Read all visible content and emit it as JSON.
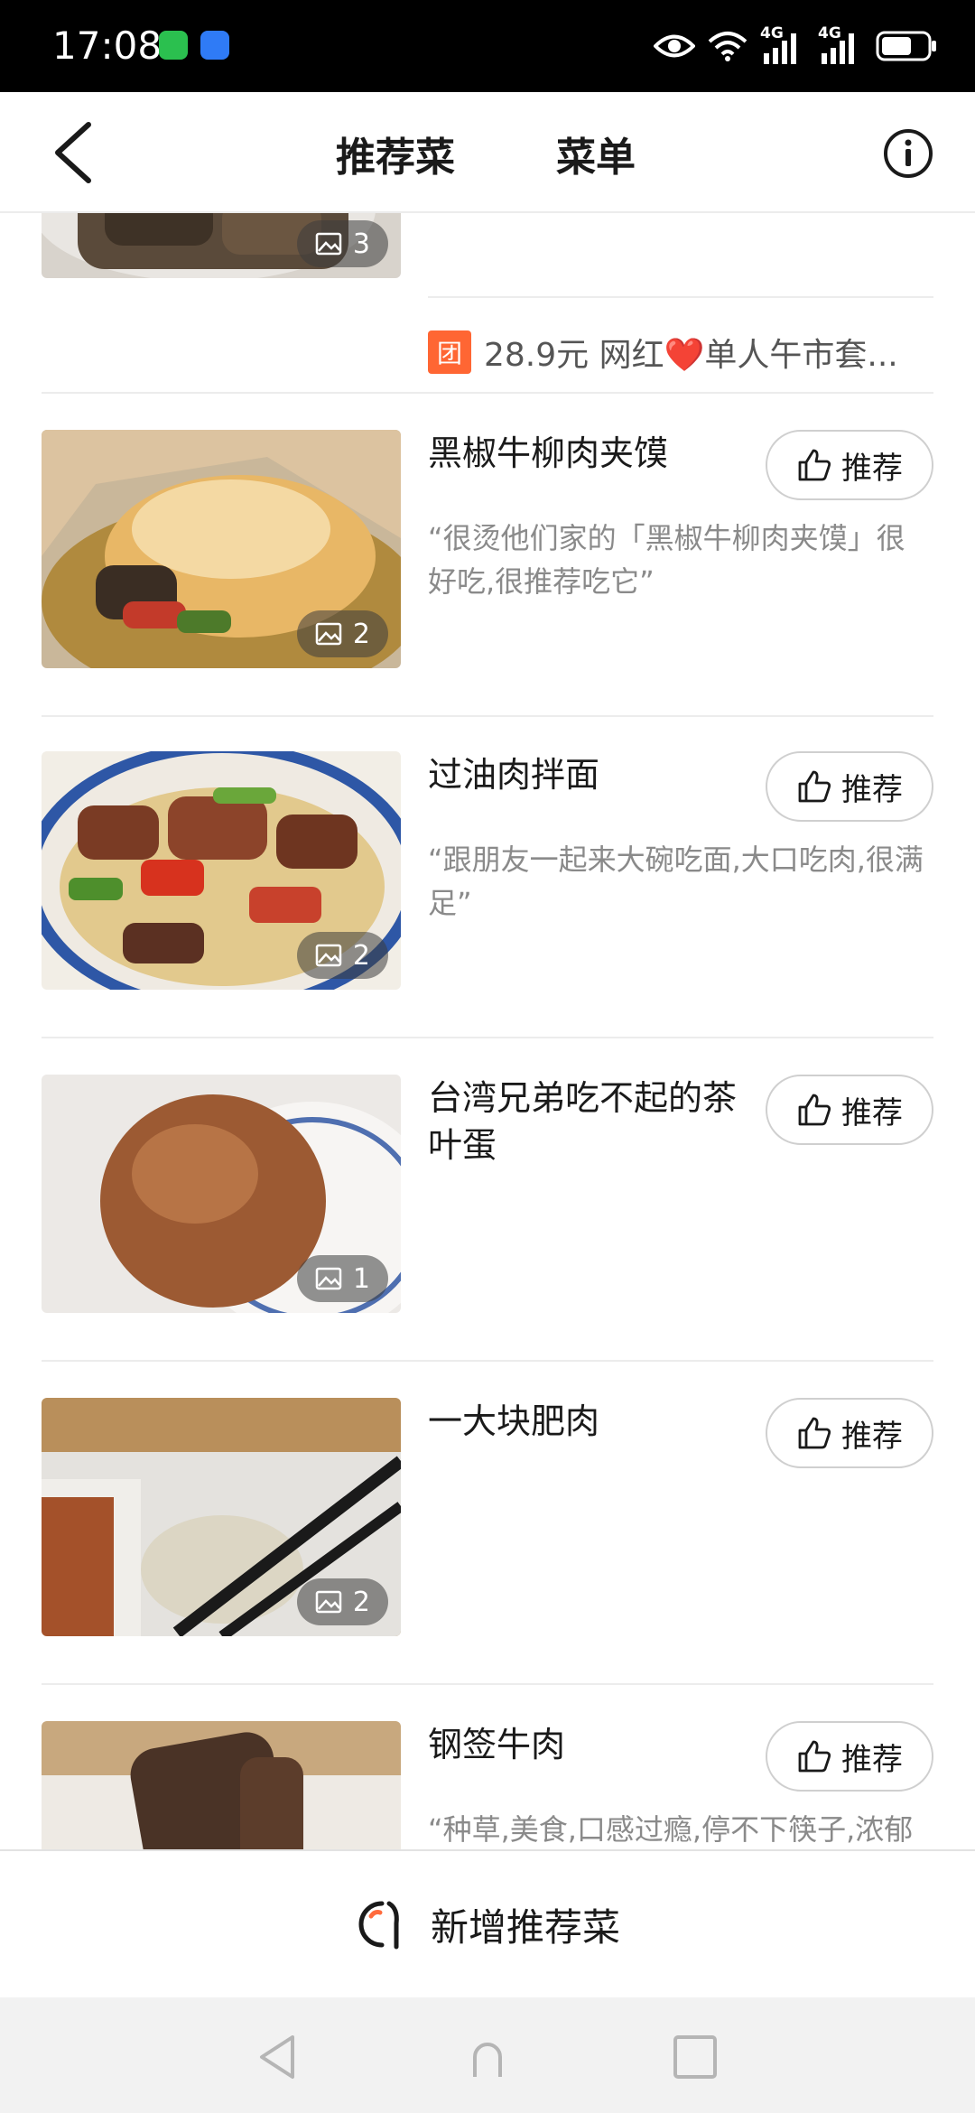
{
  "status_bar": {
    "time": "17:08",
    "network_1": "4G",
    "network_2": "4G",
    "icons": [
      "wechat-icon",
      "shield-icon",
      "eye-icon",
      "wifi-icon",
      "signal-icon",
      "battery-icon"
    ]
  },
  "header": {
    "tabs": [
      {
        "label": "推荐菜",
        "active": true
      },
      {
        "label": "菜单",
        "active": false
      }
    ],
    "accent_color": "#ff6b3d"
  },
  "top_item": {
    "image_count": "3",
    "promo_badge": "团",
    "promo_text": "28.9元 网红❤️单人午市套..."
  },
  "dishes": [
    {
      "name": "黑椒牛柳肉夹馍",
      "quote": "“很烫他们家的「黑椒牛柳肉夹馍」很好吃,很推荐吃它”",
      "image_count": "2",
      "button_label": "推荐"
    },
    {
      "name": "过油肉拌面",
      "quote": "“跟朋友一起来大碗吃面,大口吃肉,很满足”",
      "image_count": "2",
      "button_label": "推荐"
    },
    {
      "name": "台湾兄弟吃不起的茶叶蛋",
      "quote": "",
      "image_count": "1",
      "button_label": "推荐"
    },
    {
      "name": "一大块肥肉",
      "quote": "",
      "image_count": "2",
      "button_label": "推荐"
    },
    {
      "name": "钢签牛肉",
      "quote": "“种草,美食,口感过瘾,停不下筷子,浓郁",
      "image_count": "",
      "button_label": "推荐"
    }
  ],
  "bottom_bar": {
    "add_label": "新增推荐菜"
  }
}
